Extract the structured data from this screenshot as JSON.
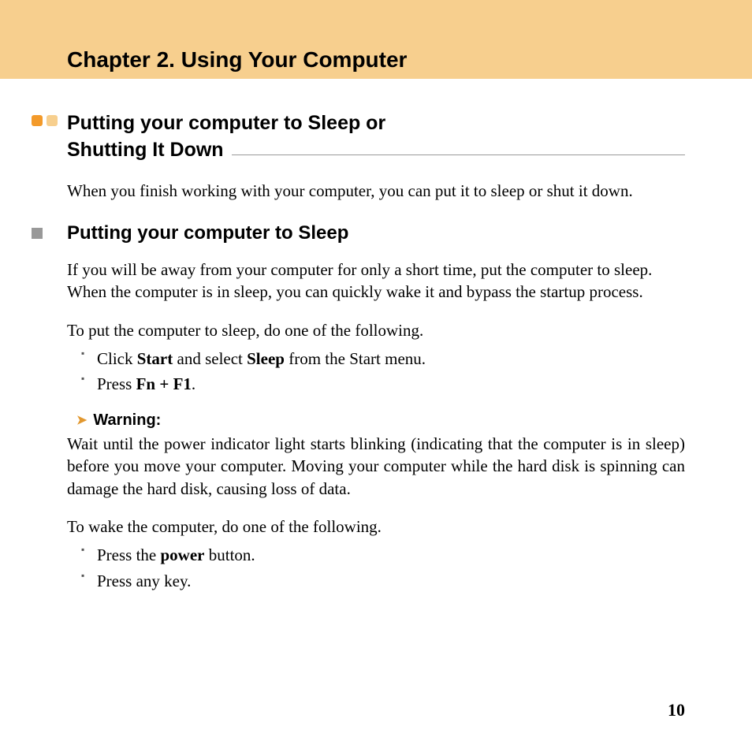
{
  "chapter_title": "Chapter 2. Using Your Computer",
  "section": {
    "title_line1": "Putting your computer to Sleep or",
    "title_line2": "Shutting It Down",
    "intro": "When you finish working with your computer, you can put it to sleep or shut it down."
  },
  "sub": {
    "title": "Putting your computer to Sleep",
    "p1": "If you will be away from your computer for only a short time, put the computer to sleep.",
    "p2": "When the computer is in sleep, you can quickly wake it and bypass the startup process.",
    "lead_sleep": "To put the computer to sleep, do one of the following.",
    "steps_sleep_1_pre": "Click ",
    "steps_sleep_1_b1": "Start",
    "steps_sleep_1_mid": " and select ",
    "steps_sleep_1_b2": "Sleep",
    "steps_sleep_1_post": " from the Start menu.",
    "steps_sleep_2_pre": "Press ",
    "steps_sleep_2_b": "Fn + F1",
    "steps_sleep_2_post": ".",
    "warn_label": "Warning:",
    "warn_body": "Wait until the power indicator light starts blinking (indicating that the computer is in sleep) before you move your computer. Moving your computer while the hard disk is spinning can damage the hard disk, causing loss of data.",
    "lead_wake": "To wake the computer, do one of the following.",
    "steps_wake_1_pre": "Press the ",
    "steps_wake_1_b": "power",
    "steps_wake_1_post": " button.",
    "steps_wake_2": "Press any key."
  },
  "page_number": "10"
}
